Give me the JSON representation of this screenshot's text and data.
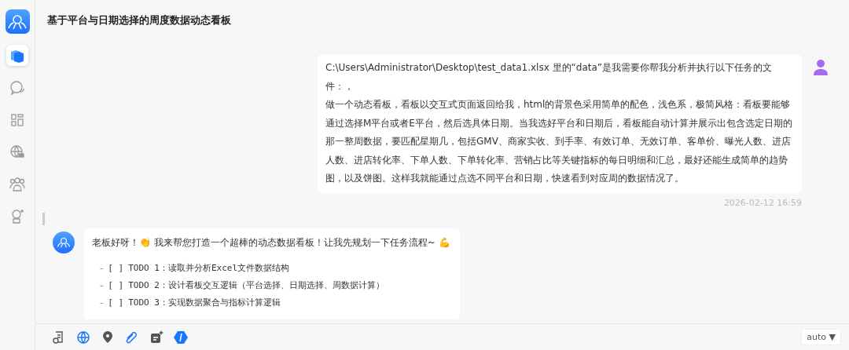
{
  "sidebar": {
    "items": [
      {
        "kind": "cube",
        "selected": true
      },
      {
        "kind": "chat",
        "selected": false
      },
      {
        "kind": "grid",
        "selected": false
      },
      {
        "kind": "globe",
        "selected": false
      },
      {
        "kind": "people",
        "selected": false
      },
      {
        "kind": "bot",
        "selected": false
      }
    ]
  },
  "header": {
    "title": "基于平台与日期选择的周度数据动态看板"
  },
  "user_message": {
    "paragraphs": [
      "C:\\Users\\Administrator\\Desktop\\test_data1.xlsx 里的“data”是我需要你帮我分析并执行以下任务的文件：，",
      "做一个动态看板，看板以交互式页面返回给我，html的背景色采用简单的配色，浅色系，极简风格：看板要能够通过选择M平台或者E平台，然后选具体日期。当我选好平台和日期后，看板能自动计算并展示出包含选定日期的那一整周数据，要匹配星期几，包括GMV、商家实收、到手率、有效订单、无效订单、客单价、曝光人数、进店人数、进店转化率、下单人数、下单转化率、营销占比等关键指标的每日明细和汇总，最好还能生成简单的趋势图，以及饼图。这样我就能通过点选不同平台和日期，快速看到对应周的数据情况了。"
    ],
    "time": "2026-02-12 16:59"
  },
  "bot_message": {
    "greeting": "老板好呀！👏 我来帮您打造一个超棒的动态数据看板！让我先规划一下任务流程~ 💪",
    "todos": [
      {
        "bullet": "-",
        "box": "[ ]",
        "text": "TODO 1：读取并分析Excel文件数据结构"
      },
      {
        "bullet": "-",
        "box": "[ ]",
        "text": "TODO 2：设计看板交互逻辑（平台选择、日期选择、周数据计算）"
      },
      {
        "bullet": "-",
        "box": "[ ]",
        "text": "TODO 3：实现数据聚合与指标计算逻辑"
      }
    ]
  },
  "toolbar": {
    "tools": [
      {
        "kind": "doc"
      },
      {
        "kind": "globe"
      },
      {
        "kind": "pin"
      },
      {
        "kind": "clip"
      },
      {
        "kind": "sparkle"
      },
      {
        "kind": "code"
      }
    ],
    "model": "auto ▼"
  }
}
